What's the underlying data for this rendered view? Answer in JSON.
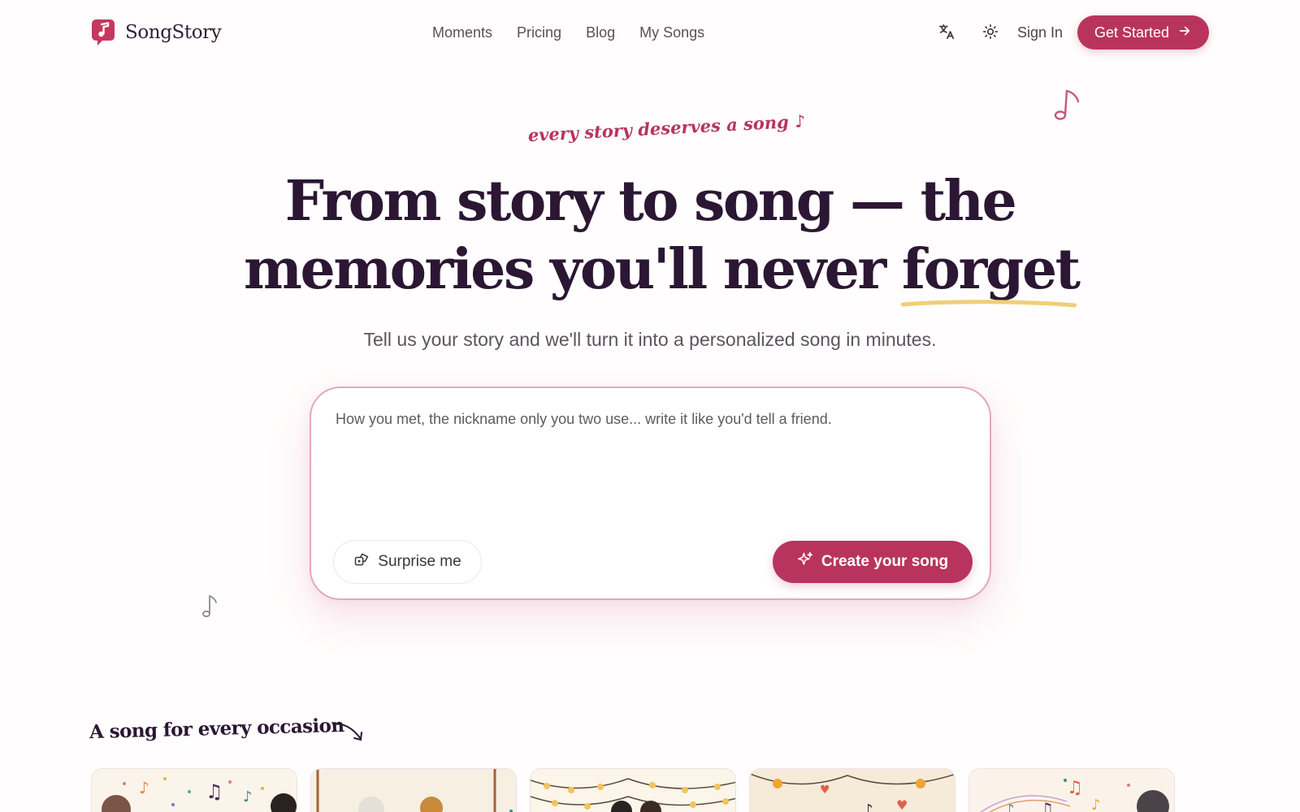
{
  "brand": {
    "name": "SongStory"
  },
  "nav": [
    {
      "label": "Moments"
    },
    {
      "label": "Pricing"
    },
    {
      "label": "Blog"
    },
    {
      "label": "My Songs"
    }
  ],
  "header": {
    "sign_in": "Sign In",
    "get_started": "Get Started"
  },
  "hero": {
    "tagline": "every story deserves a song ♪",
    "headline_line1": "From story to song — the",
    "headline_line2_prefix": "memories you'll never ",
    "headline_line2_highlight": "forget",
    "subtitle": "Tell us your story and we'll turn it into a personalized song in minutes."
  },
  "story_box": {
    "placeholder": "How you met, the nickname only you two use... write it like you'd tell a friend.",
    "value": "",
    "surprise_label": "Surprise me",
    "create_label": "Create your song"
  },
  "occasions": {
    "title": "A song for every occasion",
    "cards": [
      {
        "name": "occasion-card-1"
      },
      {
        "name": "occasion-card-2"
      },
      {
        "name": "occasion-card-3"
      },
      {
        "name": "occasion-card-4"
      },
      {
        "name": "occasion-card-5"
      }
    ]
  },
  "icons": {
    "logo": "music-note-bubble-icon",
    "translate": "translate-icon",
    "theme": "sun-icon",
    "arrow": "arrow-right-icon",
    "dice": "dice-icon",
    "sparkle": "sparkle-icon"
  },
  "colors": {
    "accent": "#b8345f",
    "heading": "#2b1733",
    "underline": "#f0cf7a",
    "box_border": "#e3a8bd"
  }
}
